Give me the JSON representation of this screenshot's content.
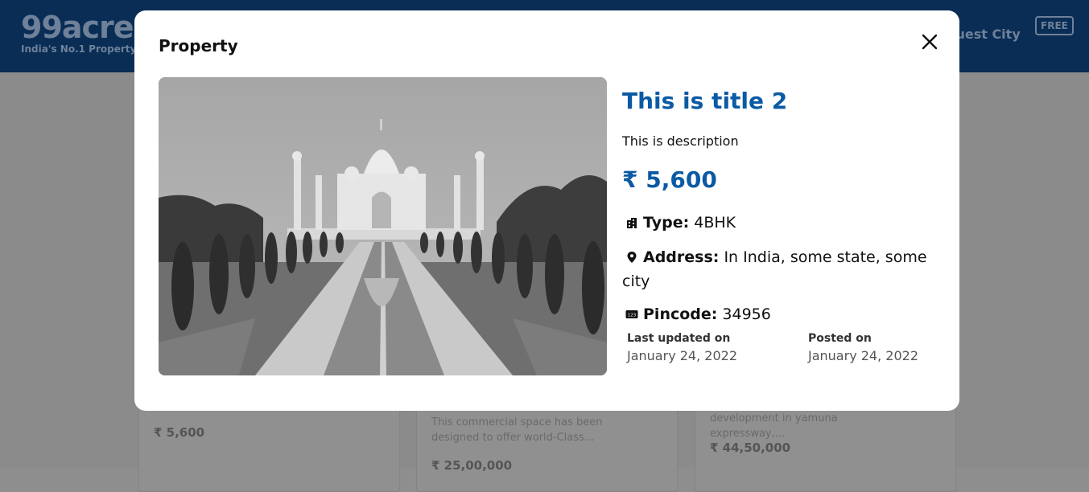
{
  "background": {
    "logo": {
      "name": "99acres",
      "tagline": "India's No.1 Property"
    },
    "request_city": "quest City",
    "free_badge": "FREE",
    "cards": [
      {
        "price": "₹ 5,600"
      },
      {
        "description": "This commercial space has been designed to offer world-Class...",
        "price": "₹ 25,00,000"
      },
      {
        "description": "development in yamuna expressway,...",
        "price": "₹ 44,50,000"
      }
    ]
  },
  "modal": {
    "header": "Property",
    "property": {
      "title": "This is title 2",
      "description": "This is description",
      "price": "₹ 5,600",
      "type_label": "Type:",
      "type_value": "4BHK",
      "address_label": "Address:",
      "address_value": "In India, some state, some city",
      "pincode_label": "Pincode:",
      "pincode_value": "34956",
      "last_updated_label": "Last updated on",
      "last_updated_value": "January 24, 2022",
      "posted_label": "Posted on",
      "posted_value": "January 24, 2022"
    },
    "icons": {
      "close": "close-icon",
      "type": "building-icon",
      "address": "map-pin-icon",
      "pincode": "pincode-icon"
    }
  },
  "colors": {
    "accent": "#0b5aa3",
    "header_bg": "#0a2d55"
  }
}
